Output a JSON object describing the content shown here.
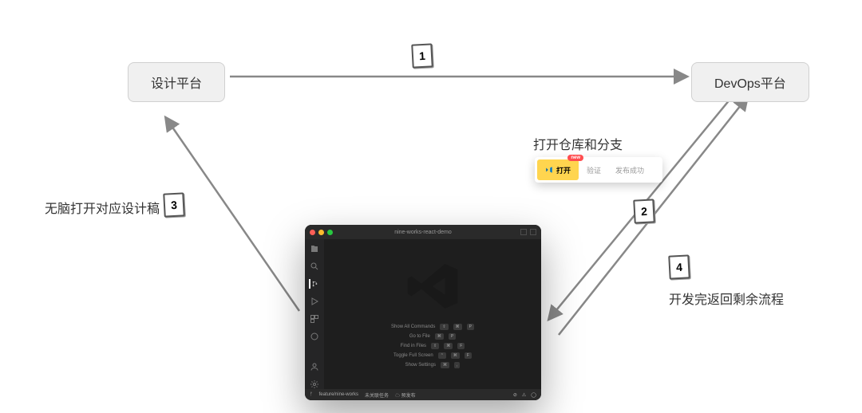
{
  "nodes": {
    "design_platform": "设计平台",
    "devops_platform": "DevOps平台"
  },
  "steps": {
    "s1": "1",
    "s2": "2",
    "s3": "3",
    "s4": "4"
  },
  "labels": {
    "step2_title": "打开仓库和分支",
    "step3_title": "无脑打开对应设计稿",
    "step4_title": "开发完返回剩余流程"
  },
  "toolbar": {
    "open": "打开",
    "open_badge": "new",
    "verify": "验证",
    "publish": "发布成功"
  },
  "vscode": {
    "title": "nine-works-react-demo",
    "commands": {
      "show_all": "Show All Commands",
      "goto_file": "Go to File",
      "find_in_files": "Find in Files",
      "toggle_fullscreen": "Toggle Full Screen",
      "show_settings": "Show Settings"
    },
    "keys": {
      "cmd_shift_p": [
        "⇧",
        "⌘",
        "P"
      ],
      "cmd_p": [
        "⌘",
        "P"
      ],
      "cmd_shift_f": [
        "⇧",
        "⌘",
        "F"
      ],
      "ctrl_cmd_f": [
        "⌃",
        "⌘",
        "F"
      ],
      "cmd_comma": [
        "⌘",
        ","
      ]
    },
    "status": {
      "branch": "feature/nine-works",
      "sync": "未关联任务",
      "env": "预发布"
    },
    "traffic": {
      "red": "#ff5f57",
      "yellow": "#febc2e",
      "green": "#28c840"
    }
  }
}
